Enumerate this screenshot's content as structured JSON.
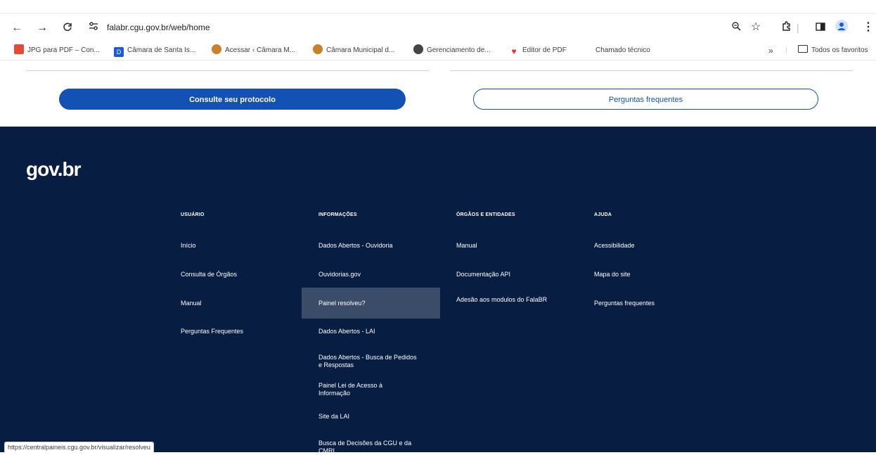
{
  "browser": {
    "url": "falabr.cgu.gov.br/web/home",
    "bookmarks": [
      {
        "label": "JPG para PDF – Con...",
        "icon": "pdf-icon",
        "color": "#e34a3a"
      },
      {
        "label": "Câmara de Santa Is...",
        "icon": "d-logo-icon",
        "color": "#1a5bd6"
      },
      {
        "label": "Acessar ‹ Câmara M...",
        "icon": "crest-icon",
        "color": "#c9812a"
      },
      {
        "label": "Câmara Municipal d...",
        "icon": "crest-icon",
        "color": "#c9812a"
      },
      {
        "label": "Gerenciamento de...",
        "icon": "globe-icon",
        "color": "#444444"
      },
      {
        "label": "Editor de PDF",
        "icon": "heart-icon",
        "color": "#e0343c"
      },
      {
        "label": "Chamado técnico",
        "icon": "",
        "color": ""
      }
    ],
    "more_label": "»",
    "all_bookmarks": "Todos os favoritos"
  },
  "page": {
    "consult_button": "Consulte seu protocolo",
    "faq_button": "Perguntas frequentes"
  },
  "footer": {
    "logo": "gov.br",
    "columns": [
      {
        "heading": "USUÁRIO",
        "links": [
          "Início",
          "Consulta de Órgãos",
          "Manual",
          "Perguntas Frequentes"
        ]
      },
      {
        "heading": "INFORMAÇÕES",
        "links": [
          "Dados Abertos - Ouvidoria",
          "Ouvidorias.gov",
          "Painel resolveu?",
          "Dados Abertos - LAI",
          "Dados Abertos - Busca de Pedidos e Respostas",
          "Painel Lei de Acesso à Informação",
          "Site da LAI",
          "Busca de Decisões da CGU e da CMRI"
        ]
      },
      {
        "heading": "ÓRGÃOS E ENTIDADES",
        "links": [
          "Manual",
          "Documentação API",
          "Adesão aos modulos do FalaBR"
        ]
      },
      {
        "heading": "AJUDA",
        "links": [
          "Acessibilidade",
          "Mapa do site",
          "Perguntas frequentes"
        ]
      }
    ]
  },
  "status_bar": "https://centralpaineis.cgu.gov.br/visualizar/resolveu",
  "colors": {
    "primary": "#1351b4",
    "footer_bg": "#071d41",
    "hover": "#3b4c68"
  }
}
